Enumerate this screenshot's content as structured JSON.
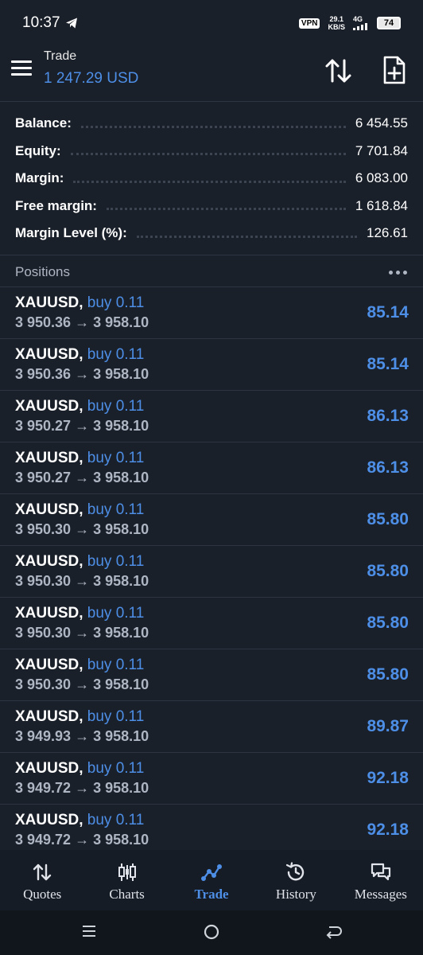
{
  "status_bar": {
    "time": "10:37",
    "vpn": "VPN",
    "net_speed_value": "29.1",
    "net_speed_unit": "KB/S",
    "network_type": "4G",
    "battery": "74"
  },
  "header": {
    "title": "Trade",
    "balance": "1 247.29 USD"
  },
  "summary": [
    {
      "label": "Balance:",
      "value": "6 454.55"
    },
    {
      "label": "Equity:",
      "value": "7 701.84"
    },
    {
      "label": "Margin:",
      "value": "6 083.00"
    },
    {
      "label": "Free margin:",
      "value": "1 618.84"
    },
    {
      "label": "Margin Level (%):",
      "value": "126.61"
    }
  ],
  "positions_title": "Positions",
  "positions": [
    {
      "symbol": "XAUUSD,",
      "side": "buy 0.11",
      "prices": "3 950.36 → 3 958.10",
      "profit": "85.14"
    },
    {
      "symbol": "XAUUSD,",
      "side": "buy 0.11",
      "prices": "3 950.36 → 3 958.10",
      "profit": "85.14"
    },
    {
      "symbol": "XAUUSD,",
      "side": "buy 0.11",
      "prices": "3 950.27 → 3 958.10",
      "profit": "86.13"
    },
    {
      "symbol": "XAUUSD,",
      "side": "buy 0.11",
      "prices": "3 950.27 → 3 958.10",
      "profit": "86.13"
    },
    {
      "symbol": "XAUUSD,",
      "side": "buy 0.11",
      "prices": "3 950.30 → 3 958.10",
      "profit": "85.80"
    },
    {
      "symbol": "XAUUSD,",
      "side": "buy 0.11",
      "prices": "3 950.30 → 3 958.10",
      "profit": "85.80"
    },
    {
      "symbol": "XAUUSD,",
      "side": "buy 0.11",
      "prices": "3 950.30 → 3 958.10",
      "profit": "85.80"
    },
    {
      "symbol": "XAUUSD,",
      "side": "buy 0.11",
      "prices": "3 950.30 → 3 958.10",
      "profit": "85.80"
    },
    {
      "symbol": "XAUUSD,",
      "side": "buy 0.11",
      "prices": "3 949.93 → 3 958.10",
      "profit": "89.87"
    },
    {
      "symbol": "XAUUSD,",
      "side": "buy 0.11",
      "prices": "3 949.72 → 3 958.10",
      "profit": "92.18"
    },
    {
      "symbol": "XAUUSD,",
      "side": "buy 0.11",
      "prices": "3 949.72 → 3 958.10",
      "profit": "92.18"
    }
  ],
  "nav": [
    {
      "label": "Quotes",
      "icon": "quotes-icon"
    },
    {
      "label": "Charts",
      "icon": "charts-icon"
    },
    {
      "label": "Trade",
      "icon": "trade-icon",
      "active": true
    },
    {
      "label": "History",
      "icon": "history-icon"
    },
    {
      "label": "Messages",
      "icon": "messages-icon"
    }
  ],
  "colors": {
    "background": "#1a202a",
    "accent": "#4d8ee6",
    "muted": "#aeb6c4"
  }
}
